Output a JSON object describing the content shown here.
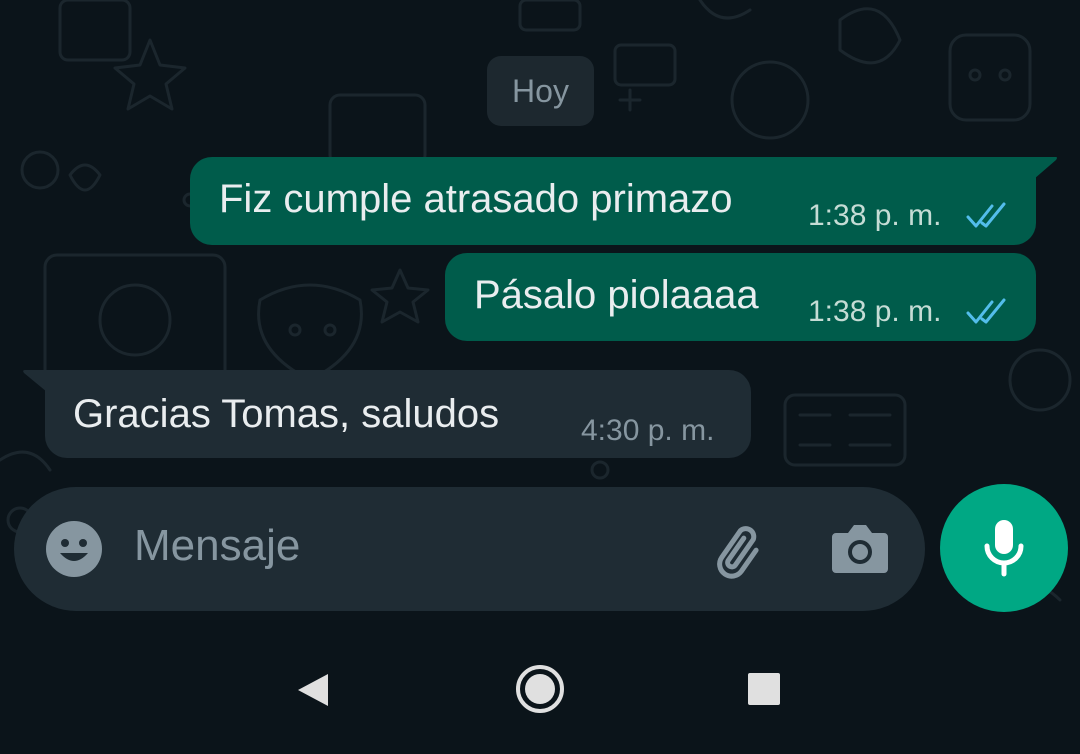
{
  "date_chip": "Hoy",
  "messages": [
    {
      "direction": "outgoing",
      "text": "Fiz cumple atrasado primazo",
      "time": "1:38 p. m.",
      "status": "read"
    },
    {
      "direction": "outgoing",
      "text": "Pásalo piolaaaa",
      "time": "1:38 p. m.",
      "status": "read"
    },
    {
      "direction": "incoming",
      "text": "Gracias Tomas, saludos",
      "time": "4:30 p. m."
    }
  ],
  "composer": {
    "placeholder": "Mensaje",
    "emoji_icon": "emoji-icon",
    "attach_icon": "paperclip-icon",
    "camera_icon": "camera-icon",
    "mic_icon": "microphone-icon"
  },
  "navbar": {
    "back_icon": "back-triangle-icon",
    "home_icon": "home-circle-icon",
    "recents_icon": "recents-square-icon"
  },
  "colors": {
    "background": "#0b141a",
    "outgoing_bubble": "#005c4b",
    "incoming_bubble": "#1f2c34",
    "read_ticks": "#53bdeb",
    "accent": "#00a884"
  }
}
